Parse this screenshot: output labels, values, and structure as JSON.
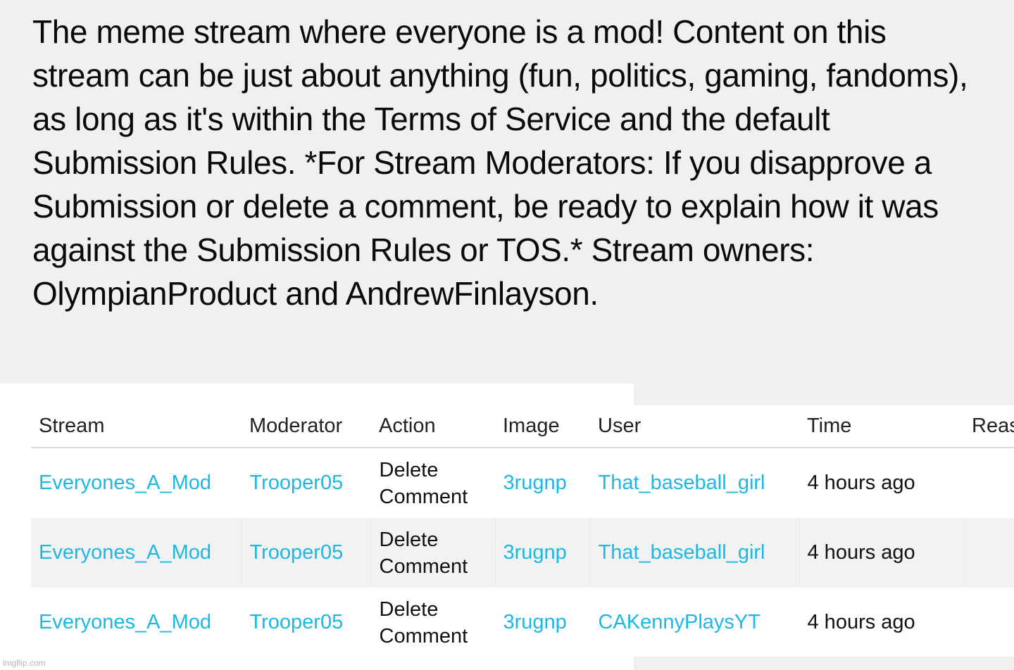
{
  "description": "The meme stream where everyone is a mod! Content on this stream can be just about anything (fun, politics, gaming, fandoms), as long as it's within the Terms of Service and the default Submission Rules. *For Stream Moderators: If you disapprove a Submission or delete a comment, be ready to explain how it was against the Submission Rules or TOS.* Stream owners: OlympianProduct and AndrewFinlayson.",
  "colors": {
    "link": "#1cb8e4",
    "page_gray": "#f0f0f0",
    "alt_row": "#f2f2f2"
  },
  "mod_log": {
    "headers": {
      "stream": "Stream",
      "moderator": "Moderator",
      "action": "Action",
      "image": "Image",
      "user": "User",
      "time": "Time",
      "reason": "Reason"
    },
    "rows": [
      {
        "stream": "Everyones_A_Mod",
        "moderator": "Trooper05",
        "action": "Delete Comment",
        "image": "3rugnp",
        "user": "That_baseball_girl",
        "time": "4 hours ago",
        "reason": ""
      },
      {
        "stream": "Everyones_A_Mod",
        "moderator": "Trooper05",
        "action": "Delete Comment",
        "image": "3rugnp",
        "user": "That_baseball_girl",
        "time": "4 hours ago",
        "reason": ""
      },
      {
        "stream": "Everyones_A_Mod",
        "moderator": "Trooper05",
        "action": "Delete Comment",
        "image": "3rugnp",
        "user": "CAKennyPlaysYT",
        "time": "4 hours ago",
        "reason": ""
      }
    ]
  },
  "watermark": "imgflip.com"
}
